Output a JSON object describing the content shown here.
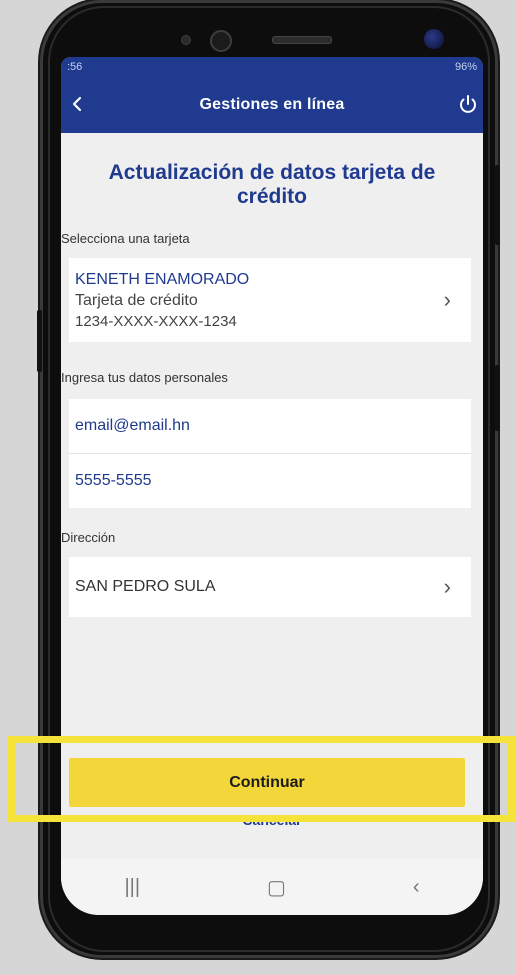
{
  "status": {
    "left": ":56 ",
    "right": "96%"
  },
  "appbar": {
    "title": "Gestiones en línea"
  },
  "heading": "Actualización de datos tarjeta de crédito",
  "card_section": {
    "label": "Selecciona una tarjeta",
    "holder": "KENETH ENAMORADO",
    "type": "Tarjeta de crédito",
    "number": "1234-XXXX-XXXX-1234"
  },
  "personal_section": {
    "label": "Ingresa tus datos personales",
    "email": "email@email.hn",
    "phone": "5555-5555"
  },
  "address_section": {
    "label": "Dirección",
    "city": "SAN PEDRO SULA"
  },
  "actions": {
    "continue": "Continuar",
    "cancel": "Cancelar"
  },
  "navbar": {
    "recents": "|||",
    "home": "▢",
    "back": "‹"
  },
  "colors": {
    "primary": "#1f3a8f",
    "button": "#f3d63a",
    "highlight": "#f5e33a"
  }
}
